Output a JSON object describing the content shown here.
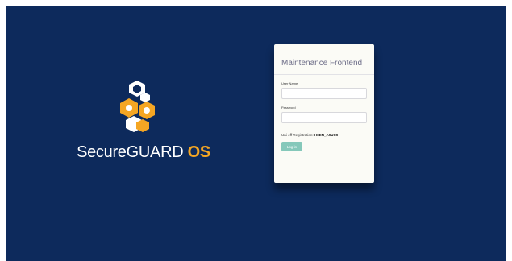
{
  "brand": {
    "name_main": "SecureGUARD",
    "name_suffix": "OS",
    "logo_icon": "hexagon-cluster-logo",
    "accent_color": "#f5a623"
  },
  "login": {
    "title": "Maintenance Frontend",
    "username_label": "User Name",
    "username_value": "",
    "password_label": "Password",
    "password_value": "",
    "registration_label": "Uni-eff Registration:",
    "registration_value": "H8EN_A9UC9",
    "login_button": "Log in",
    "button_color": "#85c8ba"
  },
  "colors": {
    "background": "#0d2a5c"
  }
}
